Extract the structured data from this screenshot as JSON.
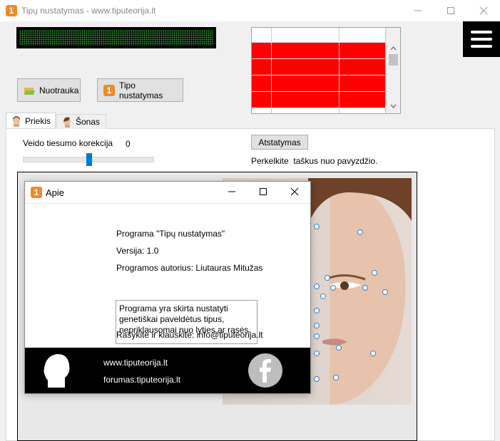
{
  "window": {
    "title": "Tipų nustatymas - www.tiputeorija.lt",
    "accent": "#f0892a"
  },
  "toolbar": {
    "photo_button": "Nuotrauka",
    "detect_button": "Tipo nustatymas"
  },
  "grid": {
    "row_color": "#ff0000",
    "rows": 4
  },
  "menu_icon": "hamburger-menu-icon",
  "tabs": [
    {
      "label": "Priekis",
      "icon": "face-front-icon",
      "active": true
    },
    {
      "label": "Šonas",
      "icon": "face-profile-icon",
      "active": false
    }
  ],
  "controls": {
    "correction_label": "Veido tiesumo korekcija",
    "correction_value": "0",
    "slider_level": 0.5,
    "reset_button": "Atstatymas",
    "instruction": "Perkelkite  taškus nuo pavyzdžio."
  },
  "about": {
    "title": "Apie",
    "program": "Programa \"Tipų nustatymas\"",
    "version": "Versija: 1.0",
    "author": "Programos autorius: Liutauras Mitužas",
    "description": "Programa yra skirta nustatyti\ngenetiškai paveldėtus tipus,\nnepriklausomai nuo lyties ar rasės.",
    "contact": "Rašykite ir klauskite: info@tiputeorija.lt",
    "website": "www.tiputeorija.lt",
    "forum": "forumas.tiputeorija.lt",
    "footer_icons": [
      "head-silhouette-icon",
      "facebook-icon"
    ]
  }
}
